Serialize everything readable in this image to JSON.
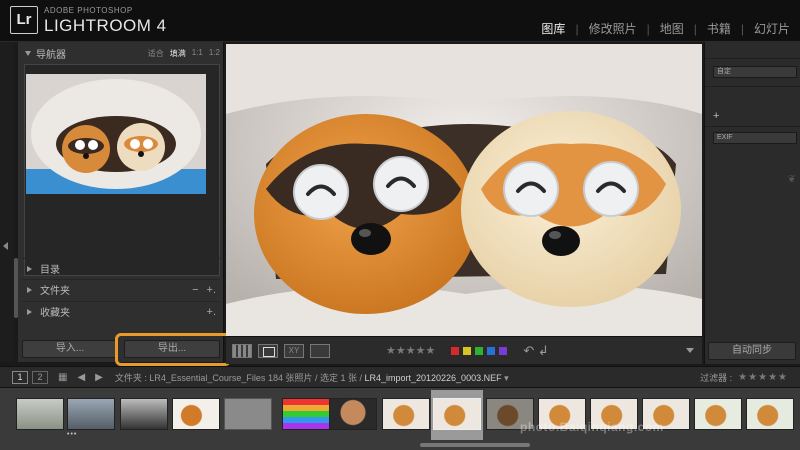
{
  "app": {
    "brand_small": "ADOBE PHOTOSHOP",
    "brand_big": "LIGHTROOM 4",
    "logo": "Lr"
  },
  "modules": [
    "图库",
    "修改照片",
    "地图",
    "书籍",
    "幻灯片"
  ],
  "active_module": "图库",
  "navigator": {
    "title": "导航器",
    "zoom_options": [
      "适合",
      "填满",
      "1:1",
      "1:2"
    ],
    "selected_zoom": "填满"
  },
  "left_panels": [
    {
      "label": "目录",
      "actions": []
    },
    {
      "label": "文件夹",
      "actions": [
        "−",
        "+."
      ]
    },
    {
      "label": "收藏夹",
      "actions": [
        "+."
      ]
    }
  ],
  "buttons": {
    "import": "导入...",
    "export": "导出...",
    "sync": "自动同步"
  },
  "right_panel": {
    "preset_select": "自定",
    "exif_select": "EXIF"
  },
  "toolbar": {
    "stars": "★★★★★",
    "color_labels": [
      "#d62a2a",
      "#d8c422",
      "#2fb02f",
      "#2a6fd6",
      "#7a3ad6"
    ]
  },
  "filmstrip_bar": {
    "page1": "1",
    "page2": "2",
    "path_prefix": "文件夹 : ",
    "folder": "LR4_Essential_Course_Files",
    "count": "184 张照片 / 选定 1 张 / ",
    "filename": "LR4_import_20120226_0003.NEF",
    "filter_label": "过滤器 :",
    "filter_stars": "★★★★★"
  },
  "watermark": "photo.Baiqinqiang.com",
  "colors": {
    "accent_highlight": "#e89a2a",
    "background": "#1a1a1a"
  }
}
